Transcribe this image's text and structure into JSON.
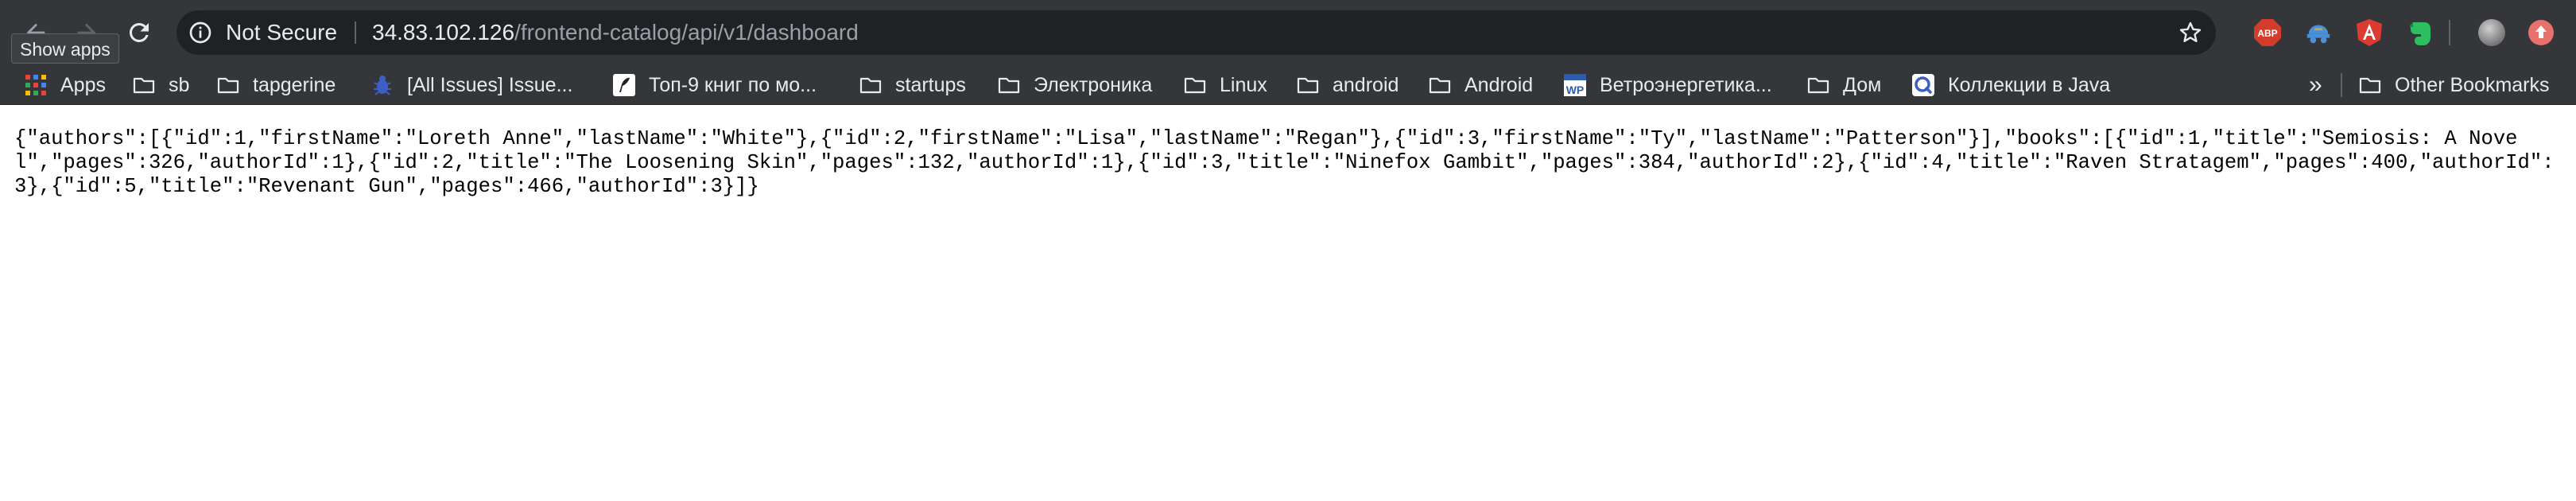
{
  "browser": {
    "security_label": "Not Secure",
    "url_host": "34.83.102.126",
    "url_path": "/frontend-catalog/api/v1/dashboard",
    "tooltip": "Show apps",
    "extensions": [
      {
        "name": "adblock-plus-icon",
        "label": "ABP"
      },
      {
        "name": "vpn-extension-icon"
      },
      {
        "name": "angular-icon"
      },
      {
        "name": "evernote-icon"
      },
      {
        "name": "profile-avatar"
      },
      {
        "name": "update-icon"
      }
    ]
  },
  "bookmarks": {
    "items": [
      {
        "label": "Apps",
        "icon": "apps-grid-icon"
      },
      {
        "label": "sb",
        "icon": "folder-icon"
      },
      {
        "label": "tapgerine",
        "icon": "folder-icon"
      },
      {
        "label": "[All Issues] Issue...",
        "icon": "bug-icon"
      },
      {
        "label": "Топ-9 книг по мо...",
        "icon": "pen-icon"
      },
      {
        "label": "startups",
        "icon": "folder-icon"
      },
      {
        "label": "Электроника",
        "icon": "folder-icon"
      },
      {
        "label": "Linux",
        "icon": "folder-icon"
      },
      {
        "label": "android",
        "icon": "folder-icon"
      },
      {
        "label": "Android",
        "icon": "folder-icon"
      },
      {
        "label": "Ветроэнергетика...",
        "icon": "wp-icon"
      },
      {
        "label": "Дом",
        "icon": "folder-icon"
      },
      {
        "label": "Коллекции в Java",
        "icon": "q-icon"
      }
    ],
    "overflow": "»",
    "other": "Other Bookmarks"
  },
  "page": {
    "body": "{\"authors\":[{\"id\":1,\"firstName\":\"Loreth Anne\",\"lastName\":\"White\"},{\"id\":2,\"firstName\":\"Lisa\",\"lastName\":\"Regan\"},{\"id\":3,\"firstName\":\"Ty\",\"lastName\":\"Patterson\"}],\"books\":[{\"id\":1,\"title\":\"Semiosis: A Novel\",\"pages\":326,\"authorId\":1},{\"id\":2,\"title\":\"The Loosening Skin\",\"pages\":132,\"authorId\":1},{\"id\":3,\"title\":\"Ninefox Gambit\",\"pages\":384,\"authorId\":2},{\"id\":4,\"title\":\"Raven Stratagem\",\"pages\":400,\"authorId\":3},{\"id\":5,\"title\":\"Revenant Gun\",\"pages\":466,\"authorId\":3}]}"
  }
}
